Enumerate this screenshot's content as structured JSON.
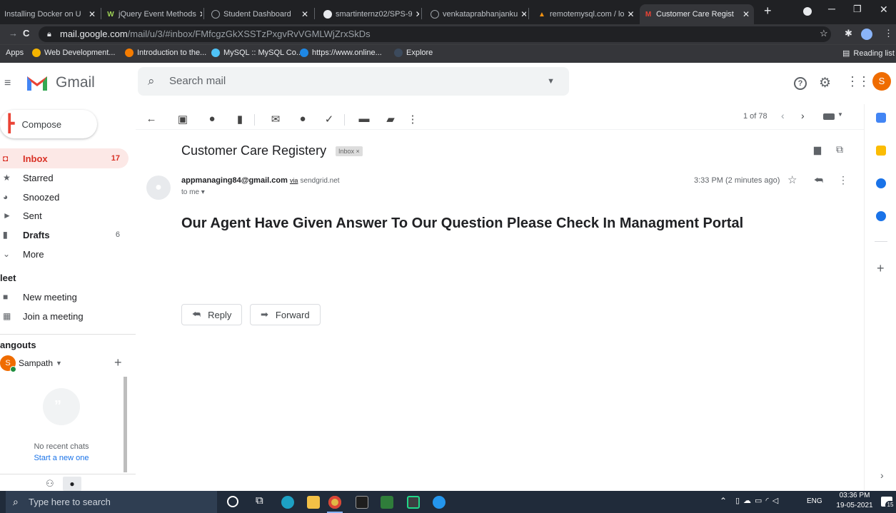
{
  "browser": {
    "tabs": [
      {
        "label": "Installing Docker on U",
        "icon": "docker-favicon"
      },
      {
        "label": "jQuery Event Methods",
        "icon": "w3schools-favicon"
      },
      {
        "label": "Student Dashboard",
        "icon": "globe-favicon"
      },
      {
        "label": "smartinternz02/SPS-9",
        "icon": "github-favicon"
      },
      {
        "label": "venkataprabhanjanku",
        "icon": "globe-favicon"
      },
      {
        "label": "remotemysql.com / lo",
        "icon": "phpmyadmin-favicon"
      },
      {
        "label": "Customer Care Regist",
        "icon": "gmail-favicon"
      }
    ],
    "url_host": "mail.google.com",
    "url_path": "/mail/u/3/#inbox/FMfcgzGkXSSTzPxgvRvVGMLWjZrxSkDs",
    "bookmarks": [
      "Apps",
      "Web Development...",
      "Introduction to the...",
      "MySQL :: MySQL Co...",
      "https://www.online...",
      "Explore"
    ],
    "reading_list": "Reading list"
  },
  "gmail": {
    "logo_text": "Gmail",
    "search_placeholder": "Search mail",
    "avatar_letter": "S",
    "compose_label": "Compose",
    "nav": [
      {
        "label": "Inbox",
        "count": "17",
        "icon": "inbox-icon"
      },
      {
        "label": "Starred",
        "count": "",
        "icon": "star-icon"
      },
      {
        "label": "Snoozed",
        "count": "",
        "icon": "clock-icon"
      },
      {
        "label": "Sent",
        "count": "",
        "icon": "send-icon"
      },
      {
        "label": "Drafts",
        "count": "6",
        "icon": "draft-icon"
      },
      {
        "label": "More",
        "count": "",
        "icon": "chevron-down-icon"
      }
    ],
    "meet_heading": "leet",
    "meet_items": [
      "New meeting",
      "Join a meeting"
    ],
    "hangouts_heading": "angouts",
    "hangouts_user": "Sampath",
    "hangouts_user_initial": "S",
    "no_chats": "No recent chats",
    "start_new": "Start a new one",
    "pagination": "1 of 78",
    "email": {
      "subject": "Customer Care Registery",
      "label_chip": "Inbox ×",
      "sender": "appmanaging84@gmail.com",
      "via": "via",
      "via_domain": "sendgrid.net",
      "to": "to me ▾",
      "time": "3:33 PM (2 minutes ago)",
      "body": "Our Agent Have Given Answer To Our Question Please Check In Managment Portal"
    },
    "reply_label": "Reply",
    "forward_label": "Forward"
  },
  "taskbar": {
    "search_placeholder": "Type here to search",
    "language": "ENG",
    "time": "03:36 PM",
    "date": "19-05-2021",
    "notification_count": "15"
  },
  "colors": {
    "gmail_red": "#d93025",
    "avatar_orange": "#ef6c00",
    "chrome_dark": "#202124"
  }
}
